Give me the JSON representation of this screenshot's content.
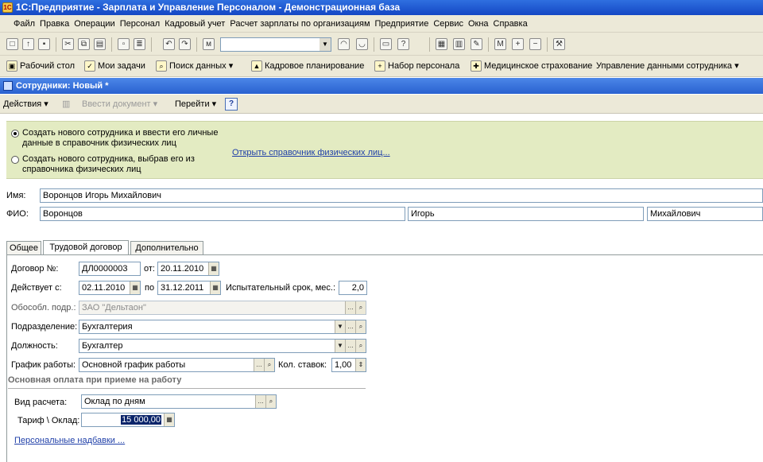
{
  "window": {
    "title": "1С:Предприятие - Зарплата и Управление Персоналом - Демонстрационная база"
  },
  "menu": [
    "Файл",
    "Правка",
    "Операции",
    "Персонал",
    "Кадровый учет",
    "Расчет зарплаты по организациям",
    "Предприятие",
    "Сервис",
    "Окна",
    "Справка"
  ],
  "panel": [
    {
      "label": "Рабочий стол",
      "icon": "desktop-icon"
    },
    {
      "label": "Мои задачи",
      "icon": "tasks-icon"
    },
    {
      "label": "Поиск данных",
      "icon": "search-data-icon"
    },
    {
      "label": "Кадровое планирование",
      "icon": "planning-icon"
    },
    {
      "label": "Набор персонала",
      "icon": "recruit-icon"
    },
    {
      "label": "Медицинское страхование",
      "icon": "medical-icon"
    },
    {
      "label": "Управление данными сотрудника",
      "icon": "employee-data-icon"
    }
  ],
  "document": {
    "title": "Сотрудники: Новый *"
  },
  "actions": {
    "actions": "Действия",
    "enter_doc": "Ввести документ",
    "goto": "Перейти",
    "help": "?"
  },
  "mode": {
    "option_new": "Создать нового сотрудника и ввести его личные данные в справочник физических лиц",
    "option_existing": "Создать нового сотрудника, выбрав его из справочника физических лиц",
    "open_link": "Открыть справочник физических лиц..."
  },
  "employee": {
    "name_label": "Имя:",
    "name": "Воронцов Игорь Михайлович",
    "fio_label": "ФИО:",
    "last_name": "Воронцов",
    "first_name": "Игорь",
    "middle_name": "Михайлович"
  },
  "tabs": [
    "Общее",
    "Трудовой договор",
    "Дополнительно"
  ],
  "contract": {
    "number_label": "Договор №:",
    "number": "ДЛ0000003",
    "from_label": "от:",
    "date": "20.11.2010",
    "valid_label": "Действует с:",
    "valid_from": "02.11.2010",
    "to_label": "по",
    "valid_to": "31.12.2011",
    "probation_label": "Испытательный срок, мес.:",
    "probation": "2,0",
    "branch_label": "Обособл. подр.:",
    "branch": "ЗАО \"Дельтаон\"",
    "department_label": "Подразделение:",
    "department": "Бухгалтерия",
    "position_label": "Должность:",
    "position": "Бухгалтер",
    "schedule_label": "График работы:",
    "schedule": "Основной график работы",
    "rates_label": "Кол. ставок:",
    "rates": "1,00"
  },
  "pay": {
    "section": "Основная оплата при приеме на работу",
    "type_label": "Вид расчета:",
    "type": "Оклад по дням",
    "tariff_label": "Тариф \\ Оклад:",
    "tariff": "15 000,00",
    "allowances_link": "Персональные надбавки ..."
  }
}
